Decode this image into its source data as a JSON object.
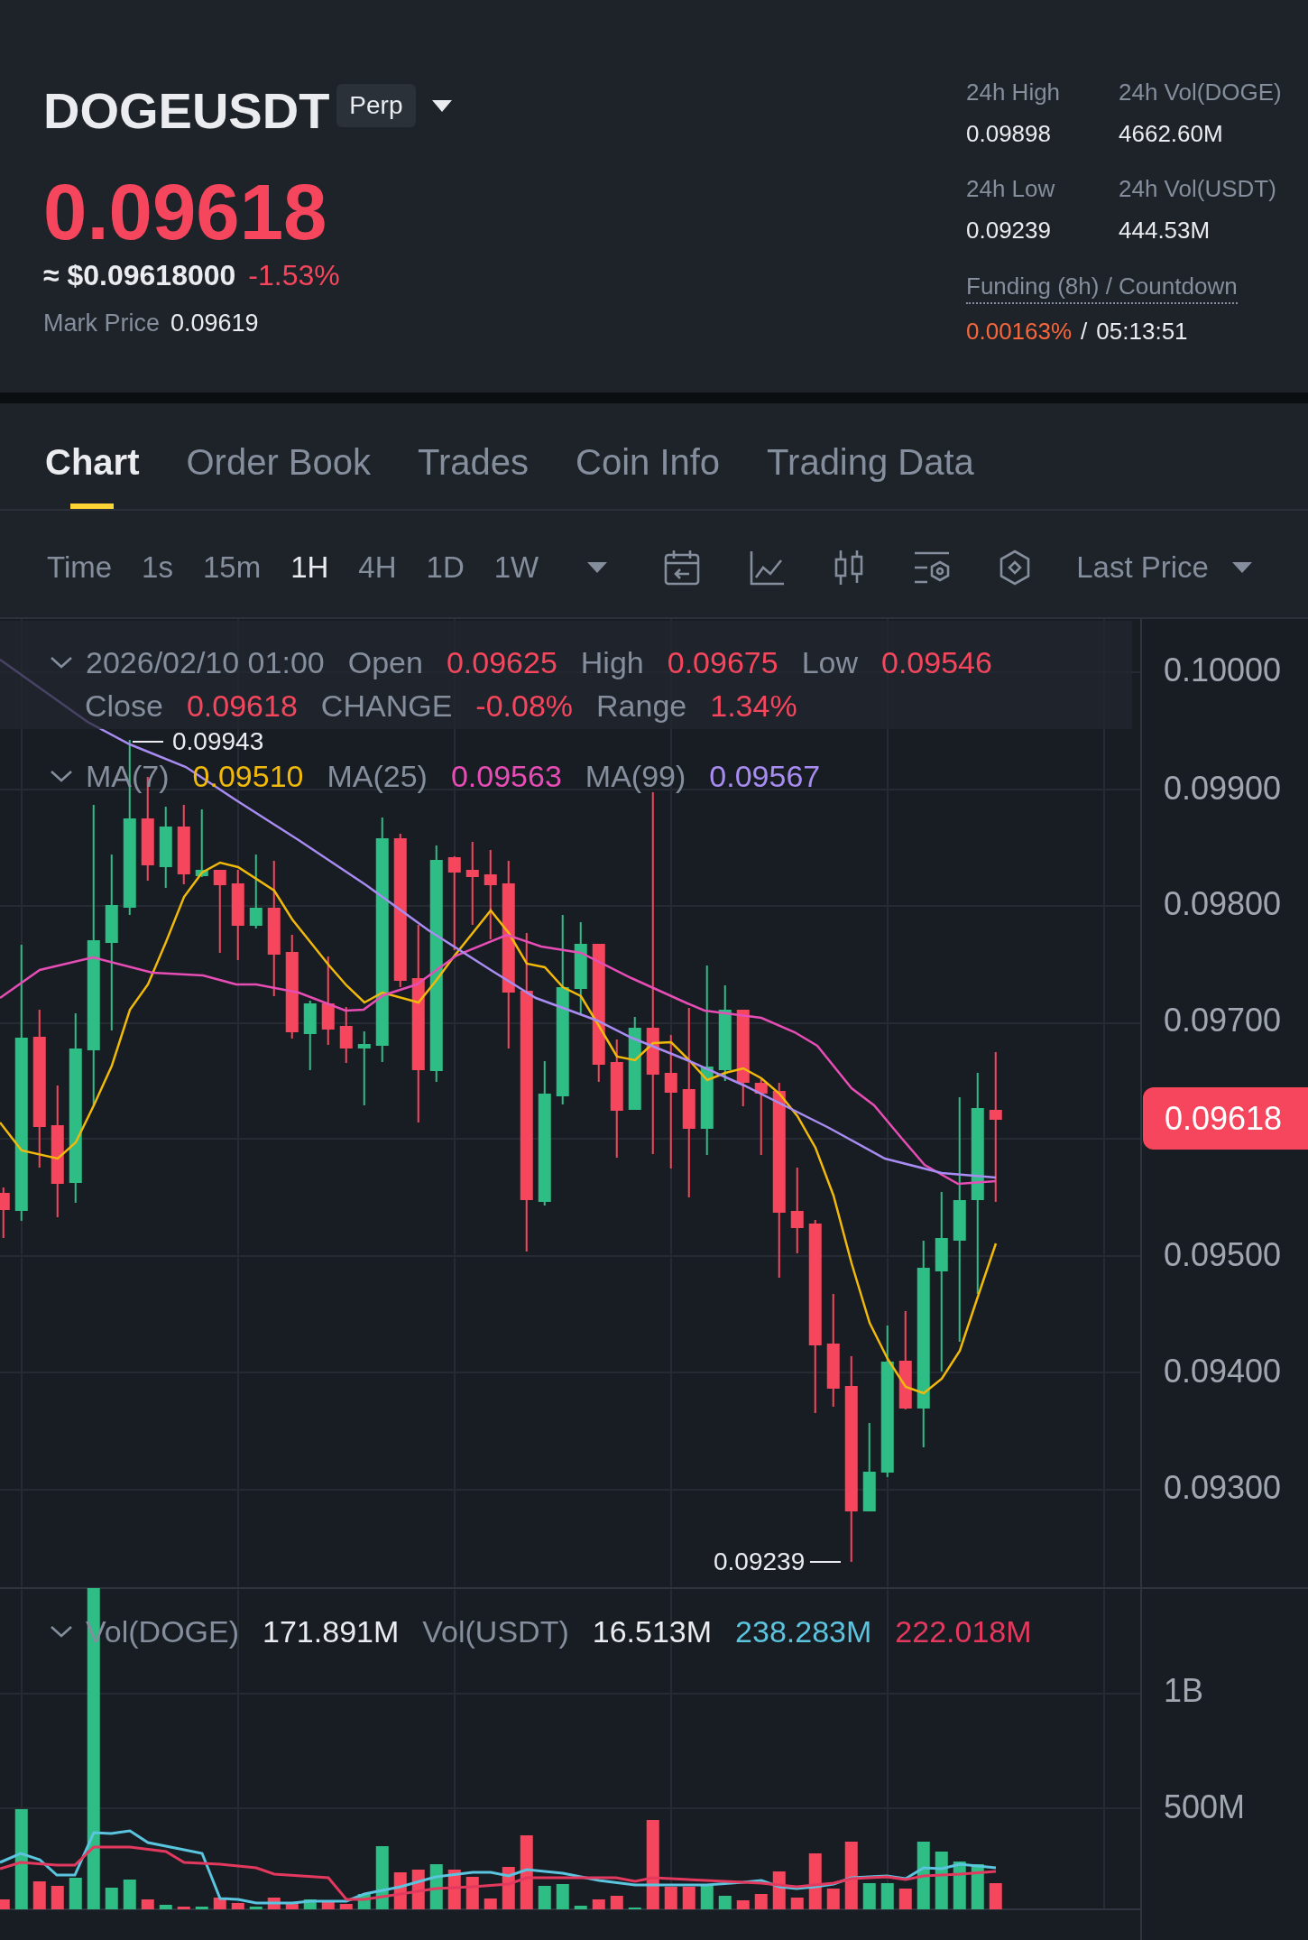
{
  "header": {
    "symbol": "DOGEUSDT",
    "contract_badge": "Perp",
    "falling": true,
    "price": "0.09618",
    "approx_price": "≈ $0.09618000",
    "change": "-1.53%",
    "mark_price": {
      "label": "Mark Price",
      "value": "0.09619"
    }
  },
  "stats": [
    {
      "label": "24h High",
      "value": "0.09898"
    },
    {
      "label": "24h Vol(DOGE)",
      "value": "4662.60M"
    },
    {
      "label": "24h Low",
      "value": "0.09239"
    },
    {
      "label": "24h Vol(USDT)",
      "value": "444.53M"
    }
  ],
  "funding": {
    "label": "Funding (8h) / Countdown",
    "rate": "0.00163%",
    "separator": "/",
    "countdown": "05:13:51"
  },
  "tabs": [
    {
      "label": "Chart",
      "selected": true
    },
    {
      "label": "Order Book",
      "selected": false
    },
    {
      "label": "Trades",
      "selected": false
    },
    {
      "label": "Coin Info",
      "selected": false
    },
    {
      "label": "Trading Data",
      "selected": false
    }
  ],
  "toolbar": {
    "intervals": [
      {
        "label": "Time",
        "selected": false
      },
      {
        "label": "1s",
        "selected": false
      },
      {
        "label": "15m",
        "selected": false
      },
      {
        "label": "1H",
        "selected": true
      },
      {
        "label": "4H",
        "selected": false
      },
      {
        "label": "1D",
        "selected": false
      },
      {
        "label": "1W",
        "selected": false
      }
    ],
    "price_type": "Last Price"
  },
  "chart": {
    "ohlc_legend": {
      "falling": true,
      "date": "2026/02/10 01:00",
      "items": [
        {
          "label": "Open",
          "value": "0.09625"
        },
        {
          "label": "High",
          "value": "0.09675"
        },
        {
          "label": "Low",
          "value": "0.09546"
        },
        {
          "label": "Close",
          "value": "0.09618"
        },
        {
          "label": "CHANGE",
          "value": "-0.08%"
        },
        {
          "label": "Range",
          "value": "1.34%"
        }
      ]
    },
    "ma_legend": [
      {
        "label": "MA(7)",
        "value": "0.09510",
        "color": "#f0b90b"
      },
      {
        "label": "MA(25)",
        "value": "0.09563",
        "color": "#e64db5"
      },
      {
        "label": "MA(99)",
        "value": "0.09567",
        "color": "#a88cf2"
      }
    ],
    "high_marker": "0.09943",
    "low_marker": "0.09239",
    "price_axis": [
      "0.10000",
      "0.09900",
      "0.09800",
      "0.09700",
      "0.09500",
      "0.09400",
      "0.09300"
    ],
    "current_price": "0.09618"
  },
  "volume": {
    "legend": [
      {
        "label": "Vol(DOGE)",
        "value": "171.891M"
      },
      {
        "label": "Vol(USDT)",
        "value": "16.513M"
      }
    ],
    "averages": [
      {
        "value": "238.283M",
        "color": "#5bc4df"
      },
      {
        "value": "222.018M",
        "color": "#e3395f"
      }
    ],
    "axis": [
      "1B",
      "500M"
    ]
  }
}
